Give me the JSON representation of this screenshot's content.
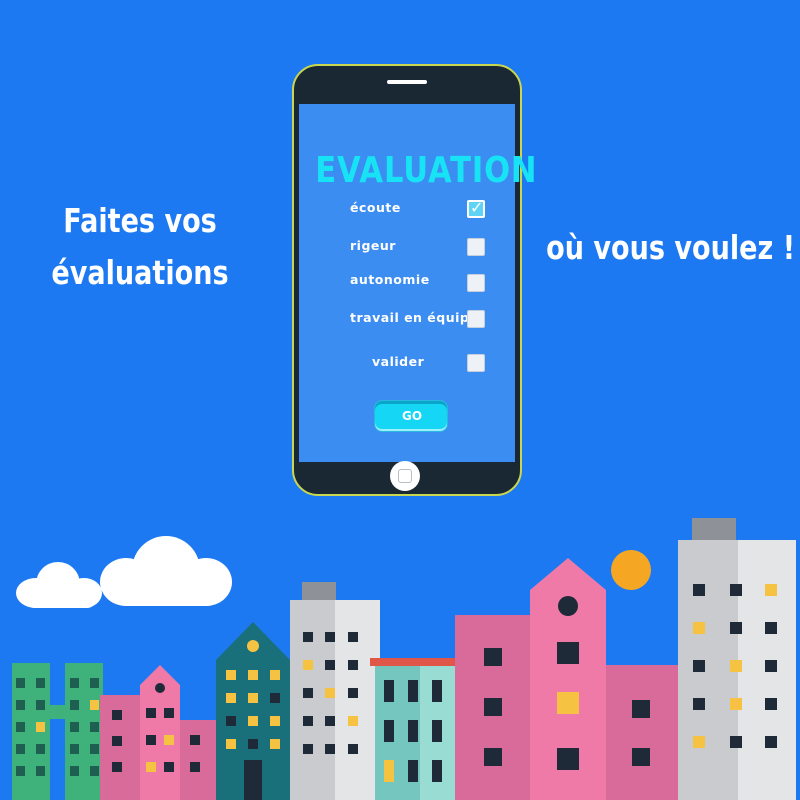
{
  "left_text": [
    "Faites vos",
    "évaluations"
  ],
  "right_text": "où vous voulez !",
  "phone": {
    "title": "EVALUATION",
    "items": [
      {
        "label": "écoute",
        "checked": true
      },
      {
        "label": "rigeur",
        "checked": false
      },
      {
        "label": "autonomie",
        "checked": false
      },
      {
        "label": "travail en équipe",
        "checked": false
      },
      {
        "label": "valider",
        "checked": false
      }
    ],
    "go_label": "GO"
  },
  "colors": {
    "background": "#1c79f2",
    "screen": "#3c8df2",
    "title": "#17e3f5",
    "sun": "#f5a623"
  },
  "icons": [
    "checkmark-icon",
    "home-button-icon",
    "sun-icon",
    "cloud-icon"
  ]
}
